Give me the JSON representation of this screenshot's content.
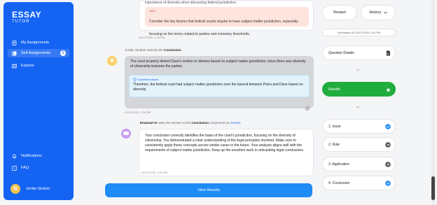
{
  "logo": {
    "line1": "ESSAY",
    "line2": "TUTOR"
  },
  "sidebar": {
    "items": [
      {
        "label": "My Assignments"
      },
      {
        "label": "Self Assignments",
        "badge": "1"
      },
      {
        "label": "Explore"
      }
    ],
    "bottom": [
      {
        "label": "Notifications"
      },
      {
        "label": "FAQ"
      }
    ],
    "user": "Jordan Student"
  },
  "chat": {
    "fade_text": "importance of diversity when discussing federal jurisdiction.",
    "hint": {
      "tag": "HINT",
      "text": "Consider the key factors that federal courts require to have subject matter jurisdiction, especially focusing on the terms related to parties and monetary thresholds."
    },
    "ts1": "02/27/2025, 1:23 PM",
    "student_meta": {
      "name": "Jordan Student",
      "middle": "submits the",
      "component": "Conclusion"
    },
    "student_text": "The court properly denied Dave's motion to dismiss based on subject matter jurisdiction, since there was diversity of citizenship between the parties.",
    "updated": {
      "tag": "Updated answer",
      "text": "Therefore, the federal court had subject matter jurisdiction over the lawsuit between Petra and Dave based on diversity."
    },
    "ts2": "02/27/2025, 1:24 PM",
    "ai_meta": {
      "name": "Emanuel AI",
      "middle": "rates the answer to this",
      "component": "Conclusion",
      "tail": "component as",
      "rating": "Correct"
    },
    "ai_text": "Your conclusion correctly identifies the basis of the court's jurisdiction, focusing on the diversity of citizenship. You demonstrated a clear understanding of the legal principles involved. Make sure to consistently apply these concepts across similar cases in the future. Your analysis aligns well with the requirements of subject matter jurisdiction. Keep up the excellent work in articulating legal conclusions.",
    "ts3": "02/27/2025, 1:24 PM",
    "view_results": "View Results"
  },
  "right": {
    "restart": "Restart",
    "history": "History",
    "submission": "Submission #0 02/27/2025, 1:20 PM",
    "question_details": "Question Details",
    "results": "Results",
    "steps": [
      {
        "label": "1. Issue",
        "status": "done"
      },
      {
        "label": "2. Rule",
        "status": "next"
      },
      {
        "label": "3. Application",
        "status": "next"
      },
      {
        "label": "4. Conclusion",
        "status": "done"
      }
    ]
  },
  "colors": {
    "primary": "#1463f3",
    "success": "#21ad3d",
    "hint_bg": "#fde4dd"
  }
}
